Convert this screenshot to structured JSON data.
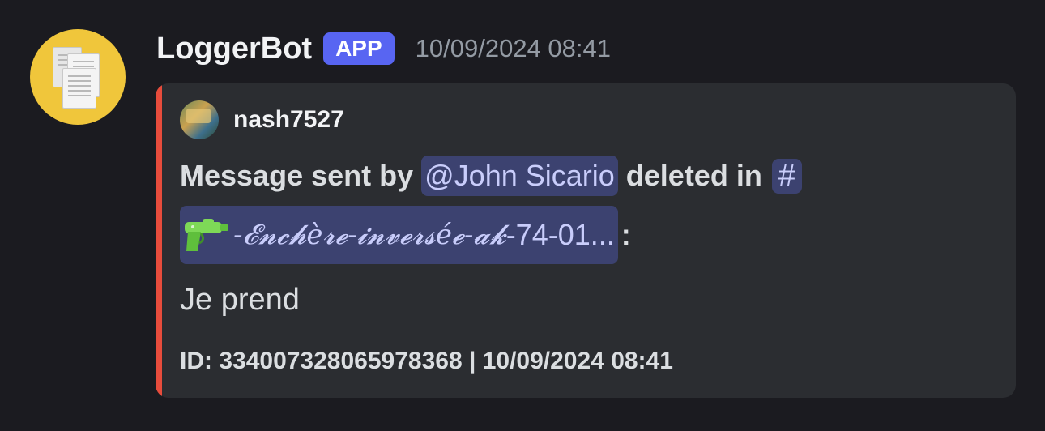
{
  "author": {
    "name": "LoggerBot",
    "badge": "APP",
    "timestamp": "10/09/2024 08:41",
    "avatar_icon": "documents-icon",
    "avatar_color": "#f0c63b"
  },
  "embed": {
    "accent_color": "#e74c3c",
    "author_name": "nash7527",
    "title_prefix": "Message sent by",
    "mention": "@John Sicario",
    "title_middle": "deleted in",
    "hash": "#",
    "channel_icon": "water-pistol-icon",
    "channel_name_styled": "-𝓔𝓷𝓬𝓱è𝓻𝓮-𝓲𝓷𝓿𝓮𝓻𝓼é𝓮-𝓪𝓴",
    "channel_name_rest": "-74-01...",
    "title_suffix": ":",
    "description": "Je prend",
    "footer": "ID: 334007328065978368 | 10/09/2024 08:41"
  }
}
